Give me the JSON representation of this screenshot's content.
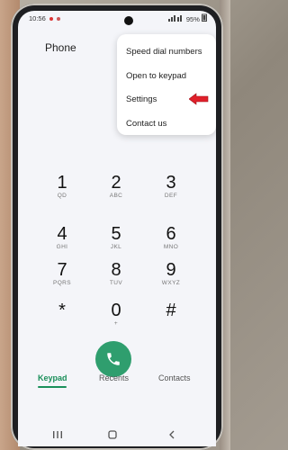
{
  "status_bar": {
    "time": "10:56",
    "battery": "95%",
    "signal_icons": "wifi-signal-battery"
  },
  "app": {
    "title": "Phone"
  },
  "menu": {
    "items": [
      "Speed dial numbers",
      "Open to keypad",
      "Settings",
      "Contact us"
    ]
  },
  "keypad": {
    "keys": [
      {
        "digit": "1",
        "letters": "QD"
      },
      {
        "digit": "2",
        "letters": "ABC"
      },
      {
        "digit": "3",
        "letters": "DEF"
      },
      {
        "digit": "4",
        "letters": "GHI"
      },
      {
        "digit": "5",
        "letters": "JKL"
      },
      {
        "digit": "6",
        "letters": "MNO"
      },
      {
        "digit": "7",
        "letters": "PQRS"
      },
      {
        "digit": "8",
        "letters": "TUV"
      },
      {
        "digit": "9",
        "letters": "WXYZ"
      },
      {
        "digit": "*",
        "letters": ""
      },
      {
        "digit": "0",
        "letters": "+"
      },
      {
        "digit": "#",
        "letters": ""
      }
    ]
  },
  "tabs": {
    "keypad": "Keypad",
    "recents": "Recents",
    "contacts": "Contacts"
  },
  "colors": {
    "accent": "#1a8f5a",
    "call": "#2f9e6e",
    "arrow": "#e0202a"
  }
}
